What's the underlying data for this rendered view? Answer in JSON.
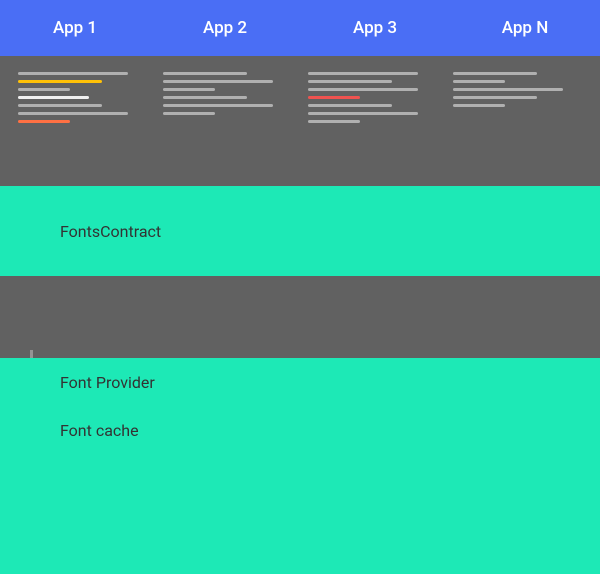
{
  "topbar": {
    "background": "#4a6ef5",
    "tabs": [
      {
        "label": "App 1"
      },
      {
        "label": "App 2"
      },
      {
        "label": "App 3"
      },
      {
        "label": "App N"
      }
    ]
  },
  "diagram": {
    "blocks": {
      "fonts_contract": "FontsContract",
      "font_provider": "Font Provider",
      "font_cache": "Font cache"
    }
  }
}
